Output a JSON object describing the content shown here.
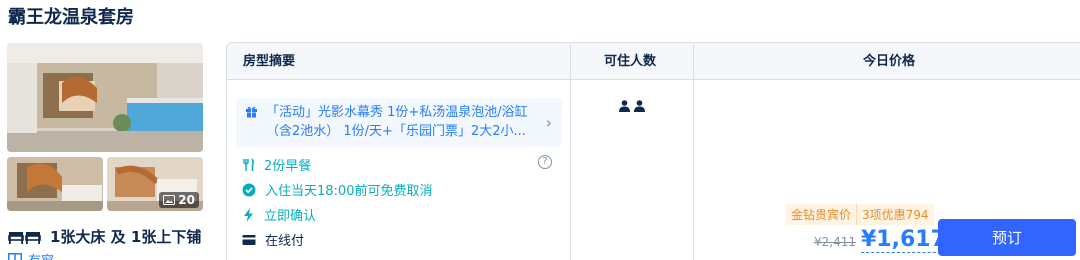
{
  "room": {
    "title": "霸王龙温泉套房",
    "photo_count": "20",
    "bed": "1张大床 及 1张上下铺",
    "window": "有窗"
  },
  "table": {
    "headers": {
      "summary": "房型摘要",
      "occupancy": "可住人数",
      "price": "今日价格"
    },
    "promo": {
      "line1": "「活动」光影水幕秀 1份+私汤温泉泡池/浴缸",
      "line2": "（含2池水） 1份/天+「乐园门票」2大2小..."
    },
    "features": {
      "breakfast": "2份早餐",
      "cancel": "入住当天18:00前可免费取消",
      "confirm": "立即确认",
      "payment": "在线付"
    },
    "guests": 2,
    "price": {
      "member_tag": "金钻贵宾价",
      "discount_tag": "3项优惠794",
      "old": "¥2,411",
      "new": "¥1,617",
      "book": "预订"
    }
  },
  "colors": {
    "accent": "#287dfa",
    "green": "#06aebd",
    "button": "#3264ff",
    "orange": "#f08a1e"
  }
}
